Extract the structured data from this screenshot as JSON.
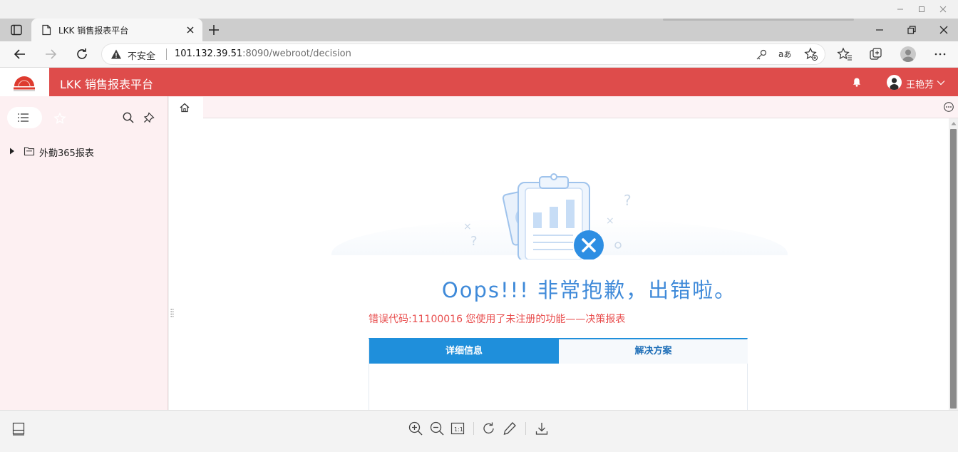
{
  "browser": {
    "tab_title": "LKK 销售报表平台",
    "security_label": "不安全",
    "url_host": "101.132.39.51",
    "url_rest": ":8090/webroot/decision"
  },
  "app": {
    "title": "LKK 销售报表平台",
    "user_name": "王艳芳",
    "brand_color": "#de4c4b"
  },
  "sidebar": {
    "items": [
      {
        "label": "外勤365报表"
      }
    ]
  },
  "error": {
    "headline": "Oops!!! 非常抱歉，出错啦。",
    "message": "错误代码:11100016 您使用了未注册的功能——决策报表",
    "tabs": [
      {
        "label": "详细信息",
        "active": true
      },
      {
        "label": "解决方案",
        "active": false
      }
    ],
    "accent_color": "#1f8fdb",
    "error_text_color": "#e84d4d"
  }
}
